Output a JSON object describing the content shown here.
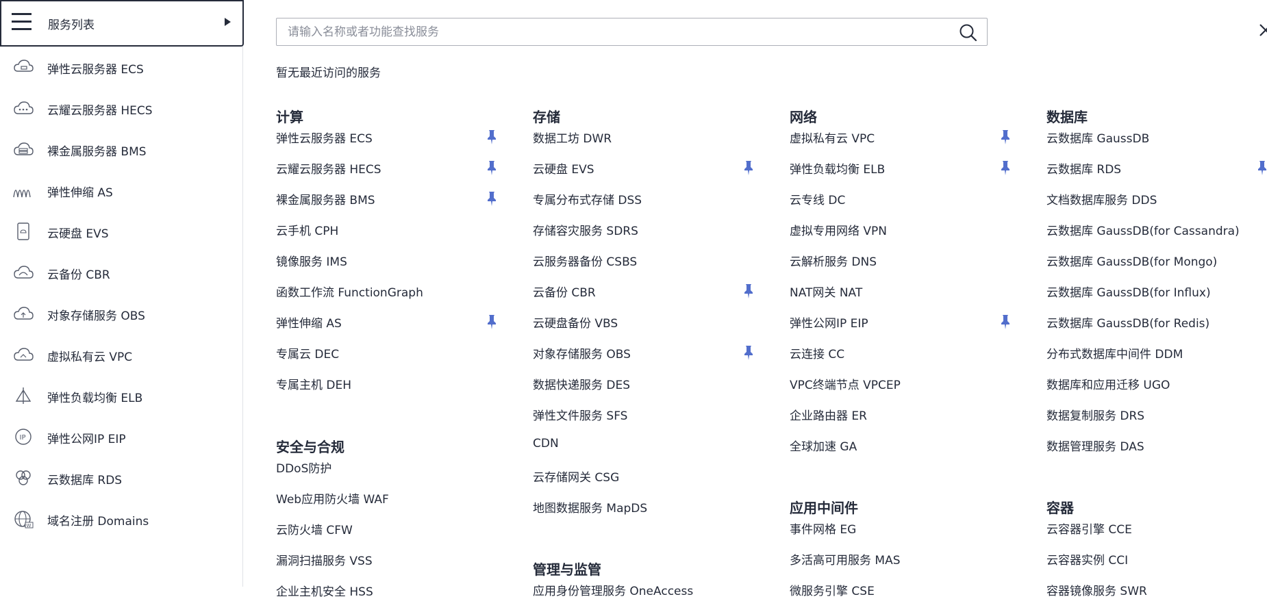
{
  "sidebar": {
    "header_label": "服务列表",
    "items": [
      {
        "label": "弹性云服务器 ECS",
        "icon": "cloud-server-icon"
      },
      {
        "label": "云耀云服务器 HECS",
        "icon": "cloud-dots-icon"
      },
      {
        "label": "裸金属服务器 BMS",
        "icon": "cloud-bms-icon"
      },
      {
        "label": "弹性伸缩 AS",
        "icon": "scaling-icon"
      },
      {
        "label": "云硬盘 EVS",
        "icon": "disk-icon"
      },
      {
        "label": "云备份 CBR",
        "icon": "backup-cloud-icon"
      },
      {
        "label": "对象存储服务 OBS",
        "icon": "object-storage-icon"
      },
      {
        "label": "虚拟私有云 VPC",
        "icon": "vpc-icon"
      },
      {
        "label": "弹性负载均衡 ELB",
        "icon": "load-balancer-icon"
      },
      {
        "label": "弹性公网IP EIP",
        "icon": "eip-icon"
      },
      {
        "label": "云数据库 RDS",
        "icon": "database-icon"
      },
      {
        "label": "域名注册 Domains",
        "icon": "globe-icon"
      }
    ]
  },
  "search": {
    "placeholder": "请输入名称或者功能查找服务",
    "value": ""
  },
  "recent": {
    "empty_text": "暂无最近访问的服务"
  },
  "colors": {
    "pin": "#526ecc",
    "text": "#252b3a",
    "border": "#adb0b8"
  },
  "categories": {
    "compute": {
      "title": "计算",
      "items": [
        "弹性云服务器 ECS",
        "云耀云服务器 HECS",
        "裸金属服务器 BMS",
        "云手机 CPH",
        "镜像服务 IMS",
        "函数工作流 FunctionGraph",
        "弹性伸缩 AS",
        "专属云 DEC",
        "专属主机 DEH"
      ],
      "pinned": [
        true,
        true,
        true,
        false,
        false,
        false,
        true,
        false,
        false
      ]
    },
    "security": {
      "title": "安全与合规",
      "items": [
        "DDoS防护",
        "Web应用防火墙 WAF",
        "云防火墙 CFW",
        "漏洞扫描服务 VSS",
        "企业主机安全 HSS"
      ],
      "pinned": [
        false,
        false,
        false,
        false,
        false
      ]
    },
    "storage": {
      "title": "存储",
      "items": [
        "数据工坊 DWR",
        "云硬盘 EVS",
        "专属分布式存储 DSS",
        "存储容灾服务 SDRS",
        "云服务器备份 CSBS",
        "云备份 CBR",
        "云硬盘备份 VBS",
        "对象存储服务 OBS",
        "数据快递服务 DES",
        "弹性文件服务 SFS",
        "CDN",
        "云存储网关 CSG",
        "地图数据服务 MapDS"
      ],
      "pinned": [
        false,
        true,
        false,
        false,
        false,
        true,
        false,
        true,
        false,
        false,
        false,
        false,
        false
      ]
    },
    "management": {
      "title": "管理与监管",
      "items": [
        "应用身份管理服务 OneAccess"
      ],
      "pinned": [
        false
      ]
    },
    "network": {
      "title": "网络",
      "items": [
        "虚拟私有云 VPC",
        "弹性负载均衡 ELB",
        "云专线 DC",
        "虚拟专用网络 VPN",
        "云解析服务 DNS",
        "NAT网关 NAT",
        "弹性公网IP EIP",
        "云连接 CC",
        "VPC终端节点 VPCEP",
        "企业路由器 ER",
        "全球加速 GA"
      ],
      "pinned": [
        true,
        true,
        false,
        false,
        false,
        false,
        true,
        false,
        false,
        false,
        false
      ]
    },
    "middleware": {
      "title": "应用中间件",
      "items": [
        "事件网格 EG",
        "多活高可用服务 MAS",
        "微服务引擎 CSE"
      ],
      "pinned": [
        false,
        false,
        false
      ]
    },
    "database": {
      "title": "数据库",
      "items": [
        "云数据库 GaussDB",
        "云数据库 RDS",
        "文档数据库服务 DDS",
        "云数据库 GaussDB(for Cassandra)",
        "云数据库 GaussDB(for Mongo)",
        "云数据库 GaussDB(for Influx)",
        "云数据库 GaussDB(for Redis)",
        "分布式数据库中间件 DDM",
        "数据库和应用迁移 UGO",
        "数据复制服务 DRS",
        "数据管理服务 DAS"
      ],
      "pinned": [
        false,
        true,
        false,
        false,
        false,
        false,
        false,
        false,
        false,
        false,
        false
      ]
    },
    "container": {
      "title": "容器",
      "items": [
        "云容器引擎 CCE",
        "云容器实例 CCI",
        "容器镜像服务 SWR"
      ],
      "pinned": [
        false,
        false,
        false
      ]
    }
  }
}
